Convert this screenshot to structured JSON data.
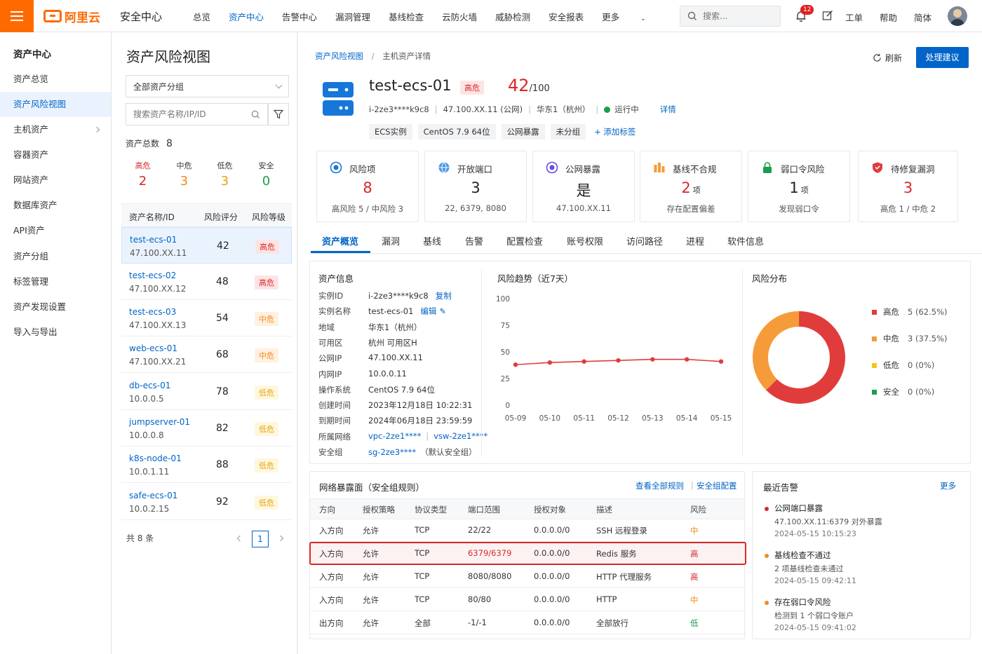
{
  "topbar": {
    "logo_text": "阿里云",
    "product": "安全中心",
    "nav": [
      "总览",
      "资产中心",
      "告警中心",
      "漏洞管理",
      "基线检查",
      "云防火墙",
      "威胁检测",
      "安全报表",
      "更多"
    ],
    "search_placeholder": "搜索...",
    "notify_count": "12",
    "links": [
      "工单",
      "帮助",
      "简体"
    ]
  },
  "sidebar": {
    "title": "资产中心",
    "items": [
      "资产总览",
      "资产风险视图",
      "主机资产",
      "容器资产",
      "网站资产",
      "数据库资产",
      "API资产",
      "资产分组",
      "标签管理",
      "资产发现设置",
      "导入与导出"
    ]
  },
  "list": {
    "title": "资产风险视图",
    "group_select": "全部资产分组",
    "search_placeholder": "搜索资产名称/IP/ID",
    "total_label": "资产总数",
    "total": "8",
    "summary": [
      {
        "label": "高危",
        "value": "2",
        "color": "#d9282a"
      },
      {
        "label": "中危",
        "value": "3",
        "color": "#f08c1e"
      },
      {
        "label": "低危",
        "value": "3",
        "color": "#e4a514"
      },
      {
        "label": "安全",
        "value": "0",
        "color": "#1a9e4b"
      }
    ],
    "headers": [
      "资产名称/ID",
      "风险评分",
      "风险等级"
    ],
    "rows": [
      {
        "name": "test-ecs-01",
        "ip": "47.100.XX.11",
        "score": "42",
        "level": "高危",
        "cls": "tag-high"
      },
      {
        "name": "test-ecs-02",
        "ip": "47.100.XX.12",
        "score": "48",
        "level": "高危",
        "cls": "tag-high"
      },
      {
        "name": "test-ecs-03",
        "ip": "47.100.XX.13",
        "score": "54",
        "level": "中危",
        "cls": "tag-mid"
      },
      {
        "name": "web-ecs-01",
        "ip": "47.100.XX.21",
        "score": "68",
        "level": "中危",
        "cls": "tag-mid"
      },
      {
        "name": "db-ecs-01",
        "ip": "10.0.0.5",
        "score": "78",
        "level": "低危",
        "cls": "tag-low"
      },
      {
        "name": "jumpserver-01",
        "ip": "10.0.0.8",
        "score": "82",
        "level": "低危",
        "cls": "tag-low"
      },
      {
        "name": "k8s-node-01",
        "ip": "10.0.1.11",
        "score": "88",
        "level": "低危",
        "cls": "tag-low"
      },
      {
        "name": "safe-ecs-01",
        "ip": "10.0.2.15",
        "score": "92",
        "level": "低危",
        "cls": "tag-low"
      }
    ],
    "footer_total": "共 8 条",
    "page": "1"
  },
  "detail": {
    "breadcrumb": [
      "资产风险视图",
      "主机资产详情"
    ],
    "refresh": "刷新",
    "action": "处理建议",
    "name": "test-ecs-01",
    "level": "高危",
    "score": "42",
    "score_max": "/100",
    "meta": [
      "i-2ze3****k9c8",
      "47.100.XX.11 (公网)",
      "华东1（杭州）"
    ],
    "status": "运行中",
    "detail_link": "详情",
    "tags": [
      "ECS实例",
      "CentOS 7.9 64位",
      "公网暴露",
      "未分组"
    ],
    "add_tag": "+ 添加标签"
  },
  "stats": [
    {
      "title": "风险项",
      "value": "8",
      "unit": "",
      "sub": "高风险 5 / 中风险 3",
      "color": "#d9282a",
      "icon": "target-icon"
    },
    {
      "title": "开放端口",
      "value": "3",
      "unit": "",
      "sub": "22, 6379, 8080",
      "color": "#222",
      "icon": "globe-icon"
    },
    {
      "title": "公网暴露",
      "value": "是",
      "unit": "",
      "sub": "47.100.XX.11",
      "color": "#222",
      "icon": "exposure-icon"
    },
    {
      "title": "基线不合规",
      "value": "2",
      "unit": "项",
      "sub": "存在配置偏差",
      "color": "#d9282a",
      "icon": "baseline-icon"
    },
    {
      "title": "弱口令风险",
      "value": "1",
      "unit": "项",
      "sub": "发现弱口令",
      "color": "#222",
      "icon": "lock-icon"
    },
    {
      "title": "待修复漏洞",
      "value": "3",
      "unit": "",
      "sub": "高危 1 / 中危 2",
      "color": "#d9282a",
      "icon": "shield-icon"
    }
  ],
  "tabs": [
    "资产概览",
    "漏洞",
    "基线",
    "告警",
    "配置检查",
    "账号权限",
    "访问路径",
    "进程",
    "软件信息"
  ],
  "asset_info": {
    "title": "资产信息",
    "rows": [
      {
        "label": "实例ID",
        "value": "i-2ze3****k9c8",
        "action": "复制"
      },
      {
        "label": "实例名称",
        "value": "test-ecs-01",
        "action": "编辑"
      },
      {
        "label": "地域",
        "value": "华东1（杭州）"
      },
      {
        "label": "可用区",
        "value": "杭州 可用区H"
      },
      {
        "label": "公网IP",
        "value": "47.100.XX.11"
      },
      {
        "label": "内网IP",
        "value": "10.0.0.11"
      },
      {
        "label": "操作系统",
        "value": "CentOS 7.9 64位"
      },
      {
        "label": "创建时间",
        "value": "2023年12月18日 10:22:31"
      },
      {
        "label": "到期时间",
        "value": "2024年06月18日 23:59:59"
      },
      {
        "label": "所属网络",
        "value": "vpc-2ze1****",
        "value2": "vsw-2ze1****"
      },
      {
        "label": "安全组",
        "value": "sg-2ze3****",
        "note": "（默认安全组）"
      }
    ]
  },
  "chart_data": [
    {
      "type": "line",
      "title": "风险趋势（近7天）",
      "x": [
        "05-09",
        "05-10",
        "05-11",
        "05-12",
        "05-13",
        "05-14",
        "05-15"
      ],
      "series": [
        {
          "values": [
            38,
            40,
            41,
            42,
            43,
            43,
            41
          ]
        }
      ],
      "ylim": [
        0,
        100
      ],
      "yticks": [
        "100",
        "75",
        "50",
        "25",
        "0"
      ],
      "color": "#e03c3c"
    },
    {
      "type": "pie",
      "title": "风险分布",
      "categories": [
        "高危",
        "中危",
        "低危",
        "安全"
      ],
      "values": [
        5,
        3,
        0,
        0
      ],
      "labels": [
        "5 (62.5%)",
        "3 (37.5%)",
        "0 (0%)",
        "0 (0%)"
      ],
      "colors": [
        "#e03c3c",
        "#f59b3a",
        "#f5c518",
        "#1a9e4b"
      ]
    }
  ],
  "network": {
    "title": "网络暴露面（安全组规则）",
    "link1": "查看全部规则",
    "link2": "安全组配置",
    "headers": [
      "方向",
      "授权策略",
      "协议类型",
      "端口范围",
      "授权对象",
      "描述",
      "风险"
    ],
    "rows": [
      {
        "dir": "入方向",
        "policy": "允许",
        "proto": "TCP",
        "port": "22/22",
        "obj": "0.0.0.0/0",
        "desc": "SSH 远程登录",
        "risk": "中",
        "color": "#f08c1e"
      },
      {
        "dir": "入方向",
        "policy": "允许",
        "proto": "TCP",
        "port": "6379/6379",
        "obj": "0.0.0.0/0",
        "desc": "Redis 服务",
        "risk": "高",
        "color": "#d9282a"
      },
      {
        "dir": "入方向",
        "policy": "允许",
        "proto": "TCP",
        "port": "8080/8080",
        "obj": "0.0.0.0/0",
        "desc": "HTTP 代理服务",
        "risk": "高",
        "color": "#d9282a"
      },
      {
        "dir": "入方向",
        "policy": "允许",
        "proto": "TCP",
        "port": "80/80",
        "obj": "0.0.0.0/0",
        "desc": "HTTP",
        "risk": "中",
        "color": "#f08c1e"
      },
      {
        "dir": "出方向",
        "policy": "允许",
        "proto": "全部",
        "port": "-1/-1",
        "obj": "0.0.0.0/0",
        "desc": "全部放行",
        "risk": "低",
        "color": "#1a9e4b"
      }
    ]
  },
  "alerts": {
    "title": "最近告警",
    "more": "更多",
    "items": [
      {
        "title": "公网端口暴露",
        "desc": "47.100.XX.11:6379 对外暴露",
        "time": "2024-05-15 10:15:23",
        "color": "#d9282a"
      },
      {
        "title": "基线检查不通过",
        "desc": "2 项基线检查未通过",
        "time": "2024-05-15 09:42:11",
        "color": "#f08c1e"
      },
      {
        "title": "存在弱口令风险",
        "desc": "检测到 1 个弱口令账户",
        "time": "2024-05-15 09:41:02",
        "color": "#f08c1e"
      }
    ]
  }
}
